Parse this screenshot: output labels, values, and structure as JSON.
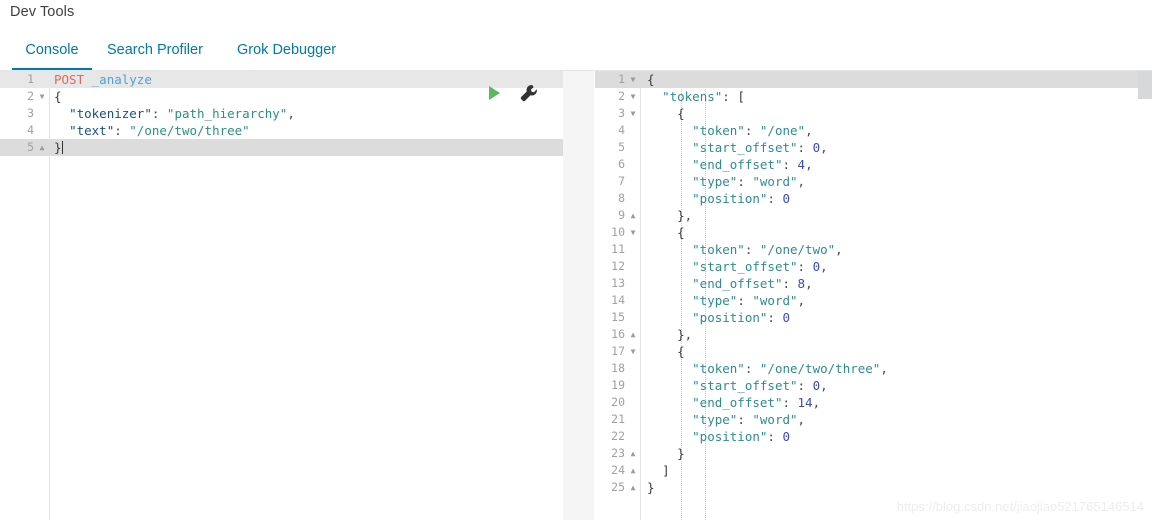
{
  "app": {
    "title": "Dev Tools"
  },
  "tabs": [
    {
      "label": "Console",
      "active": true
    },
    {
      "label": "Search Profiler",
      "active": false
    },
    {
      "label": "Grok Debugger",
      "active": false
    }
  ],
  "colors": {
    "accent": "#0079a5",
    "play_green": "#5cb85c",
    "wrench_dark": "#333333",
    "active_line": "#dcdcdc",
    "json_key": "#1a4f86",
    "json_string": "#2a9080",
    "response_key": "#2e8b94",
    "response_number": "#3b48cc",
    "http_method": "#e7655c",
    "http_path": "#4ba3d6"
  },
  "request_editor": {
    "name": "console-request-editor",
    "method": "POST",
    "path": "_analyze",
    "active_line": 5,
    "lines": [
      {
        "num": "1",
        "fold": "none",
        "text": "POST _analyze"
      },
      {
        "num": "2",
        "fold": "open",
        "text": "{"
      },
      {
        "num": "3",
        "fold": "none",
        "text": "  \"tokenizer\": \"path_hierarchy\","
      },
      {
        "num": "4",
        "fold": "none",
        "text": "  \"text\": \"/one/two/three\""
      },
      {
        "num": "5",
        "fold": "close",
        "text": "}"
      }
    ],
    "actions": {
      "play_label": "play-button",
      "wrench_label": "wrench-button"
    }
  },
  "response_editor": {
    "name": "console-response-editor",
    "active_line": 1,
    "lines": [
      {
        "num": "1",
        "fold": "open",
        "text": "{"
      },
      {
        "num": "2",
        "fold": "open",
        "text": "  \"tokens\": ["
      },
      {
        "num": "3",
        "fold": "open",
        "text": "    {"
      },
      {
        "num": "4",
        "fold": "none",
        "text": "      \"token\": \"/one\","
      },
      {
        "num": "5",
        "fold": "none",
        "text": "      \"start_offset\": 0,"
      },
      {
        "num": "6",
        "fold": "none",
        "text": "      \"end_offset\": 4,"
      },
      {
        "num": "7",
        "fold": "none",
        "text": "      \"type\": \"word\","
      },
      {
        "num": "8",
        "fold": "none",
        "text": "      \"position\": 0"
      },
      {
        "num": "9",
        "fold": "close",
        "text": "    },"
      },
      {
        "num": "10",
        "fold": "open",
        "text": "    {"
      },
      {
        "num": "11",
        "fold": "none",
        "text": "      \"token\": \"/one/two\","
      },
      {
        "num": "12",
        "fold": "none",
        "text": "      \"start_offset\": 0,"
      },
      {
        "num": "13",
        "fold": "none",
        "text": "      \"end_offset\": 8,"
      },
      {
        "num": "14",
        "fold": "none",
        "text": "      \"type\": \"word\","
      },
      {
        "num": "15",
        "fold": "none",
        "text": "      \"position\": 0"
      },
      {
        "num": "16",
        "fold": "close",
        "text": "    },"
      },
      {
        "num": "17",
        "fold": "open",
        "text": "    {"
      },
      {
        "num": "18",
        "fold": "none",
        "text": "      \"token\": \"/one/two/three\","
      },
      {
        "num": "19",
        "fold": "none",
        "text": "      \"start_offset\": 0,"
      },
      {
        "num": "20",
        "fold": "none",
        "text": "      \"end_offset\": 14,"
      },
      {
        "num": "21",
        "fold": "none",
        "text": "      \"type\": \"word\","
      },
      {
        "num": "22",
        "fold": "none",
        "text": "      \"position\": 0"
      },
      {
        "num": "23",
        "fold": "close",
        "text": "    }"
      },
      {
        "num": "24",
        "fold": "close",
        "text": "  ]"
      },
      {
        "num": "25",
        "fold": "close",
        "text": "}"
      }
    ]
  },
  "watermark": {
    "text": "https://blog.csdn.net/jiaojiao521765146514"
  }
}
